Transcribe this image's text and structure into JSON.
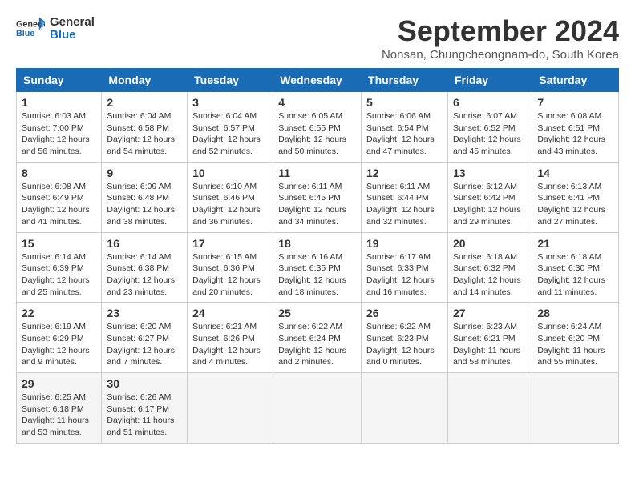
{
  "header": {
    "logo_line1": "General",
    "logo_line2": "Blue",
    "month": "September 2024",
    "location": "Nonsan, Chungcheongnam-do, South Korea"
  },
  "weekdays": [
    "Sunday",
    "Monday",
    "Tuesday",
    "Wednesday",
    "Thursday",
    "Friday",
    "Saturday"
  ],
  "weeks": [
    [
      {
        "day": "1",
        "info": "Sunrise: 6:03 AM\nSunset: 7:00 PM\nDaylight: 12 hours\nand 56 minutes."
      },
      {
        "day": "2",
        "info": "Sunrise: 6:04 AM\nSunset: 6:58 PM\nDaylight: 12 hours\nand 54 minutes."
      },
      {
        "day": "3",
        "info": "Sunrise: 6:04 AM\nSunset: 6:57 PM\nDaylight: 12 hours\nand 52 minutes."
      },
      {
        "day": "4",
        "info": "Sunrise: 6:05 AM\nSunset: 6:55 PM\nDaylight: 12 hours\nand 50 minutes."
      },
      {
        "day": "5",
        "info": "Sunrise: 6:06 AM\nSunset: 6:54 PM\nDaylight: 12 hours\nand 47 minutes."
      },
      {
        "day": "6",
        "info": "Sunrise: 6:07 AM\nSunset: 6:52 PM\nDaylight: 12 hours\nand 45 minutes."
      },
      {
        "day": "7",
        "info": "Sunrise: 6:08 AM\nSunset: 6:51 PM\nDaylight: 12 hours\nand 43 minutes."
      }
    ],
    [
      {
        "day": "8",
        "info": "Sunrise: 6:08 AM\nSunset: 6:49 PM\nDaylight: 12 hours\nand 41 minutes."
      },
      {
        "day": "9",
        "info": "Sunrise: 6:09 AM\nSunset: 6:48 PM\nDaylight: 12 hours\nand 38 minutes."
      },
      {
        "day": "10",
        "info": "Sunrise: 6:10 AM\nSunset: 6:46 PM\nDaylight: 12 hours\nand 36 minutes."
      },
      {
        "day": "11",
        "info": "Sunrise: 6:11 AM\nSunset: 6:45 PM\nDaylight: 12 hours\nand 34 minutes."
      },
      {
        "day": "12",
        "info": "Sunrise: 6:11 AM\nSunset: 6:44 PM\nDaylight: 12 hours\nand 32 minutes."
      },
      {
        "day": "13",
        "info": "Sunrise: 6:12 AM\nSunset: 6:42 PM\nDaylight: 12 hours\nand 29 minutes."
      },
      {
        "day": "14",
        "info": "Sunrise: 6:13 AM\nSunset: 6:41 PM\nDaylight: 12 hours\nand 27 minutes."
      }
    ],
    [
      {
        "day": "15",
        "info": "Sunrise: 6:14 AM\nSunset: 6:39 PM\nDaylight: 12 hours\nand 25 minutes."
      },
      {
        "day": "16",
        "info": "Sunrise: 6:14 AM\nSunset: 6:38 PM\nDaylight: 12 hours\nand 23 minutes."
      },
      {
        "day": "17",
        "info": "Sunrise: 6:15 AM\nSunset: 6:36 PM\nDaylight: 12 hours\nand 20 minutes."
      },
      {
        "day": "18",
        "info": "Sunrise: 6:16 AM\nSunset: 6:35 PM\nDaylight: 12 hours\nand 18 minutes."
      },
      {
        "day": "19",
        "info": "Sunrise: 6:17 AM\nSunset: 6:33 PM\nDaylight: 12 hours\nand 16 minutes."
      },
      {
        "day": "20",
        "info": "Sunrise: 6:18 AM\nSunset: 6:32 PM\nDaylight: 12 hours\nand 14 minutes."
      },
      {
        "day": "21",
        "info": "Sunrise: 6:18 AM\nSunset: 6:30 PM\nDaylight: 12 hours\nand 11 minutes."
      }
    ],
    [
      {
        "day": "22",
        "info": "Sunrise: 6:19 AM\nSunset: 6:29 PM\nDaylight: 12 hours\nand 9 minutes."
      },
      {
        "day": "23",
        "info": "Sunrise: 6:20 AM\nSunset: 6:27 PM\nDaylight: 12 hours\nand 7 minutes."
      },
      {
        "day": "24",
        "info": "Sunrise: 6:21 AM\nSunset: 6:26 PM\nDaylight: 12 hours\nand 4 minutes."
      },
      {
        "day": "25",
        "info": "Sunrise: 6:22 AM\nSunset: 6:24 PM\nDaylight: 12 hours\nand 2 minutes."
      },
      {
        "day": "26",
        "info": "Sunrise: 6:22 AM\nSunset: 6:23 PM\nDaylight: 12 hours\nand 0 minutes."
      },
      {
        "day": "27",
        "info": "Sunrise: 6:23 AM\nSunset: 6:21 PM\nDaylight: 11 hours\nand 58 minutes."
      },
      {
        "day": "28",
        "info": "Sunrise: 6:24 AM\nSunset: 6:20 PM\nDaylight: 11 hours\nand 55 minutes."
      }
    ],
    [
      {
        "day": "29",
        "info": "Sunrise: 6:25 AM\nSunset: 6:18 PM\nDaylight: 11 hours\nand 53 minutes."
      },
      {
        "day": "30",
        "info": "Sunrise: 6:26 AM\nSunset: 6:17 PM\nDaylight: 11 hours\nand 51 minutes."
      },
      {
        "day": "",
        "info": ""
      },
      {
        "day": "",
        "info": ""
      },
      {
        "day": "",
        "info": ""
      },
      {
        "day": "",
        "info": ""
      },
      {
        "day": "",
        "info": ""
      }
    ]
  ]
}
